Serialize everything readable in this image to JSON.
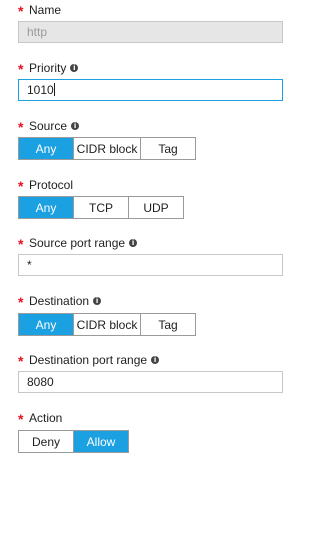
{
  "name": {
    "label": "Name",
    "value": "http"
  },
  "priority": {
    "label": "Priority",
    "value": "1010"
  },
  "source": {
    "label": "Source",
    "options": [
      "Any",
      "CIDR block",
      "Tag"
    ],
    "selected": "Any"
  },
  "protocol": {
    "label": "Protocol",
    "options": [
      "Any",
      "TCP",
      "UDP"
    ],
    "selected": "Any"
  },
  "source_port_range": {
    "label": "Source port range",
    "value": "*"
  },
  "destination": {
    "label": "Destination",
    "options": [
      "Any",
      "CIDR block",
      "Tag"
    ],
    "selected": "Any"
  },
  "destination_port_range": {
    "label": "Destination port range",
    "value": "8080"
  },
  "action": {
    "label": "Action",
    "options": [
      "Deny",
      "Allow"
    ],
    "selected": "Allow"
  },
  "required_marker": "*",
  "info_glyph": "i",
  "colors": {
    "accent": "#1ba1e2",
    "required": "#e81123",
    "disabled_bg": "#e6e6e6"
  }
}
